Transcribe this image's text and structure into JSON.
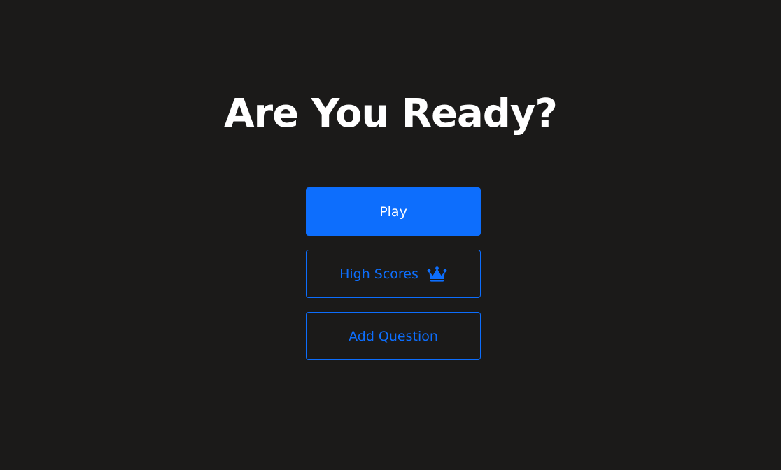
{
  "page": {
    "title": "Are You Ready?"
  },
  "menu": {
    "play_label": "Play",
    "high_scores_label": "High Scores",
    "add_question_label": "Add Question"
  },
  "icons": {
    "high_scores_icon": "crown-icon"
  },
  "colors": {
    "background": "#1b1a19",
    "accent": "#0d6efd",
    "title": "#ffffff"
  }
}
